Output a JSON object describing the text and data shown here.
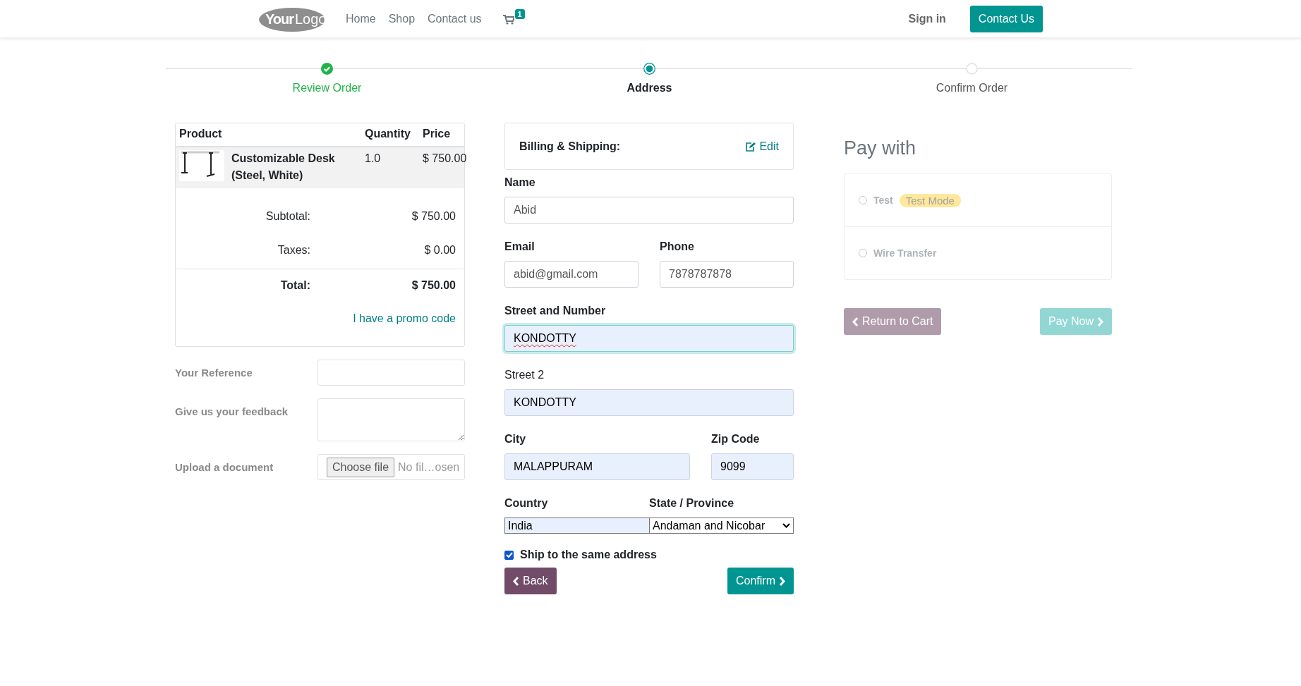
{
  "header": {
    "logo": {
      "first": "Your",
      "second": "Logo"
    },
    "nav": [
      {
        "label": "Home"
      },
      {
        "label": "Shop"
      },
      {
        "label": "Contact us"
      }
    ],
    "cart_count": "1",
    "sign_in": "Sign in",
    "contact_button": "Contact Us"
  },
  "steps": [
    {
      "label": "Review Order",
      "kind": "done"
    },
    {
      "label": "Address",
      "kind": "current"
    },
    {
      "label": "Confirm Order",
      "kind": "todo"
    }
  ],
  "cart": {
    "columns": [
      "Product",
      "Quantity",
      "Price"
    ],
    "items": [
      {
        "name": "Customizable Desk (Steel, White)",
        "quantity": "1.0",
        "price": "$ 750.00"
      }
    ],
    "subtotal_label": "Subtotal:",
    "subtotal": "$ 750.00",
    "taxes_label": "Taxes:",
    "taxes": "$ 0.00",
    "total_label": "Total:",
    "total": "$ 750.00",
    "promo_link": "I have a promo code"
  },
  "extra_fields": [
    {
      "label": "Your Reference",
      "kind": "text"
    },
    {
      "label": "Give us your feedback",
      "kind": "textarea"
    },
    {
      "label": "Upload a document",
      "kind": "file",
      "button": "Choose file",
      "value": "No fil…osen"
    }
  ],
  "billing": {
    "title": "Billing & Shipping:",
    "edit": "Edit"
  },
  "address_rows": [
    [
      {
        "label": "Name",
        "value": "Abid",
        "required": true,
        "autofilled": false,
        "focused": false,
        "misspelled": false,
        "kind": "text"
      }
    ],
    [
      {
        "label": "Email",
        "value": "abid@gmail.com",
        "required": true,
        "autofilled": false,
        "focused": false,
        "misspelled": false,
        "kind": "text"
      },
      {
        "label": "Phone",
        "value": "7878787878",
        "required": true,
        "autofilled": false,
        "focused": false,
        "misspelled": false,
        "kind": "text"
      }
    ],
    [
      {
        "label": "Street and Number",
        "value": "KONDOTTY",
        "required": true,
        "autofilled": true,
        "focused": true,
        "misspelled": true,
        "kind": "text"
      }
    ],
    [
      {
        "label": "Street 2",
        "value": "KONDOTTY",
        "required": false,
        "autofilled": true,
        "focused": false,
        "misspelled": false,
        "kind": "text"
      }
    ],
    [
      {
        "label": "City",
        "value": "MALAPPURAM",
        "required": true,
        "autofilled": true,
        "focused": false,
        "misspelled": false,
        "kind": "text"
      },
      {
        "label": "Zip Code",
        "value": "9099",
        "required": true,
        "autofilled": true,
        "focused": false,
        "misspelled": false,
        "kind": "text"
      }
    ],
    [
      {
        "label": "Country",
        "value": "India",
        "required": true,
        "autofilled": true,
        "focused": false,
        "misspelled": false,
        "kind": "plain"
      },
      {
        "label": "State / Province",
        "value": "Andaman and Nicobar",
        "required": true,
        "autofilled": false,
        "focused": false,
        "misspelled": false,
        "kind": "select"
      }
    ]
  ],
  "ship_same": {
    "label": "Ship to the same address",
    "checked": true
  },
  "back_button": "Back",
  "confirm_button": "Confirm",
  "payment": {
    "title": "Pay with",
    "disabled": true,
    "methods": [
      {
        "label": "Test",
        "badge": "Test Mode",
        "selected": false
      },
      {
        "label": "Wire Transfer",
        "selected": false
      }
    ],
    "return_button": "Return to Cart",
    "pay_button": "Pay Now"
  }
}
